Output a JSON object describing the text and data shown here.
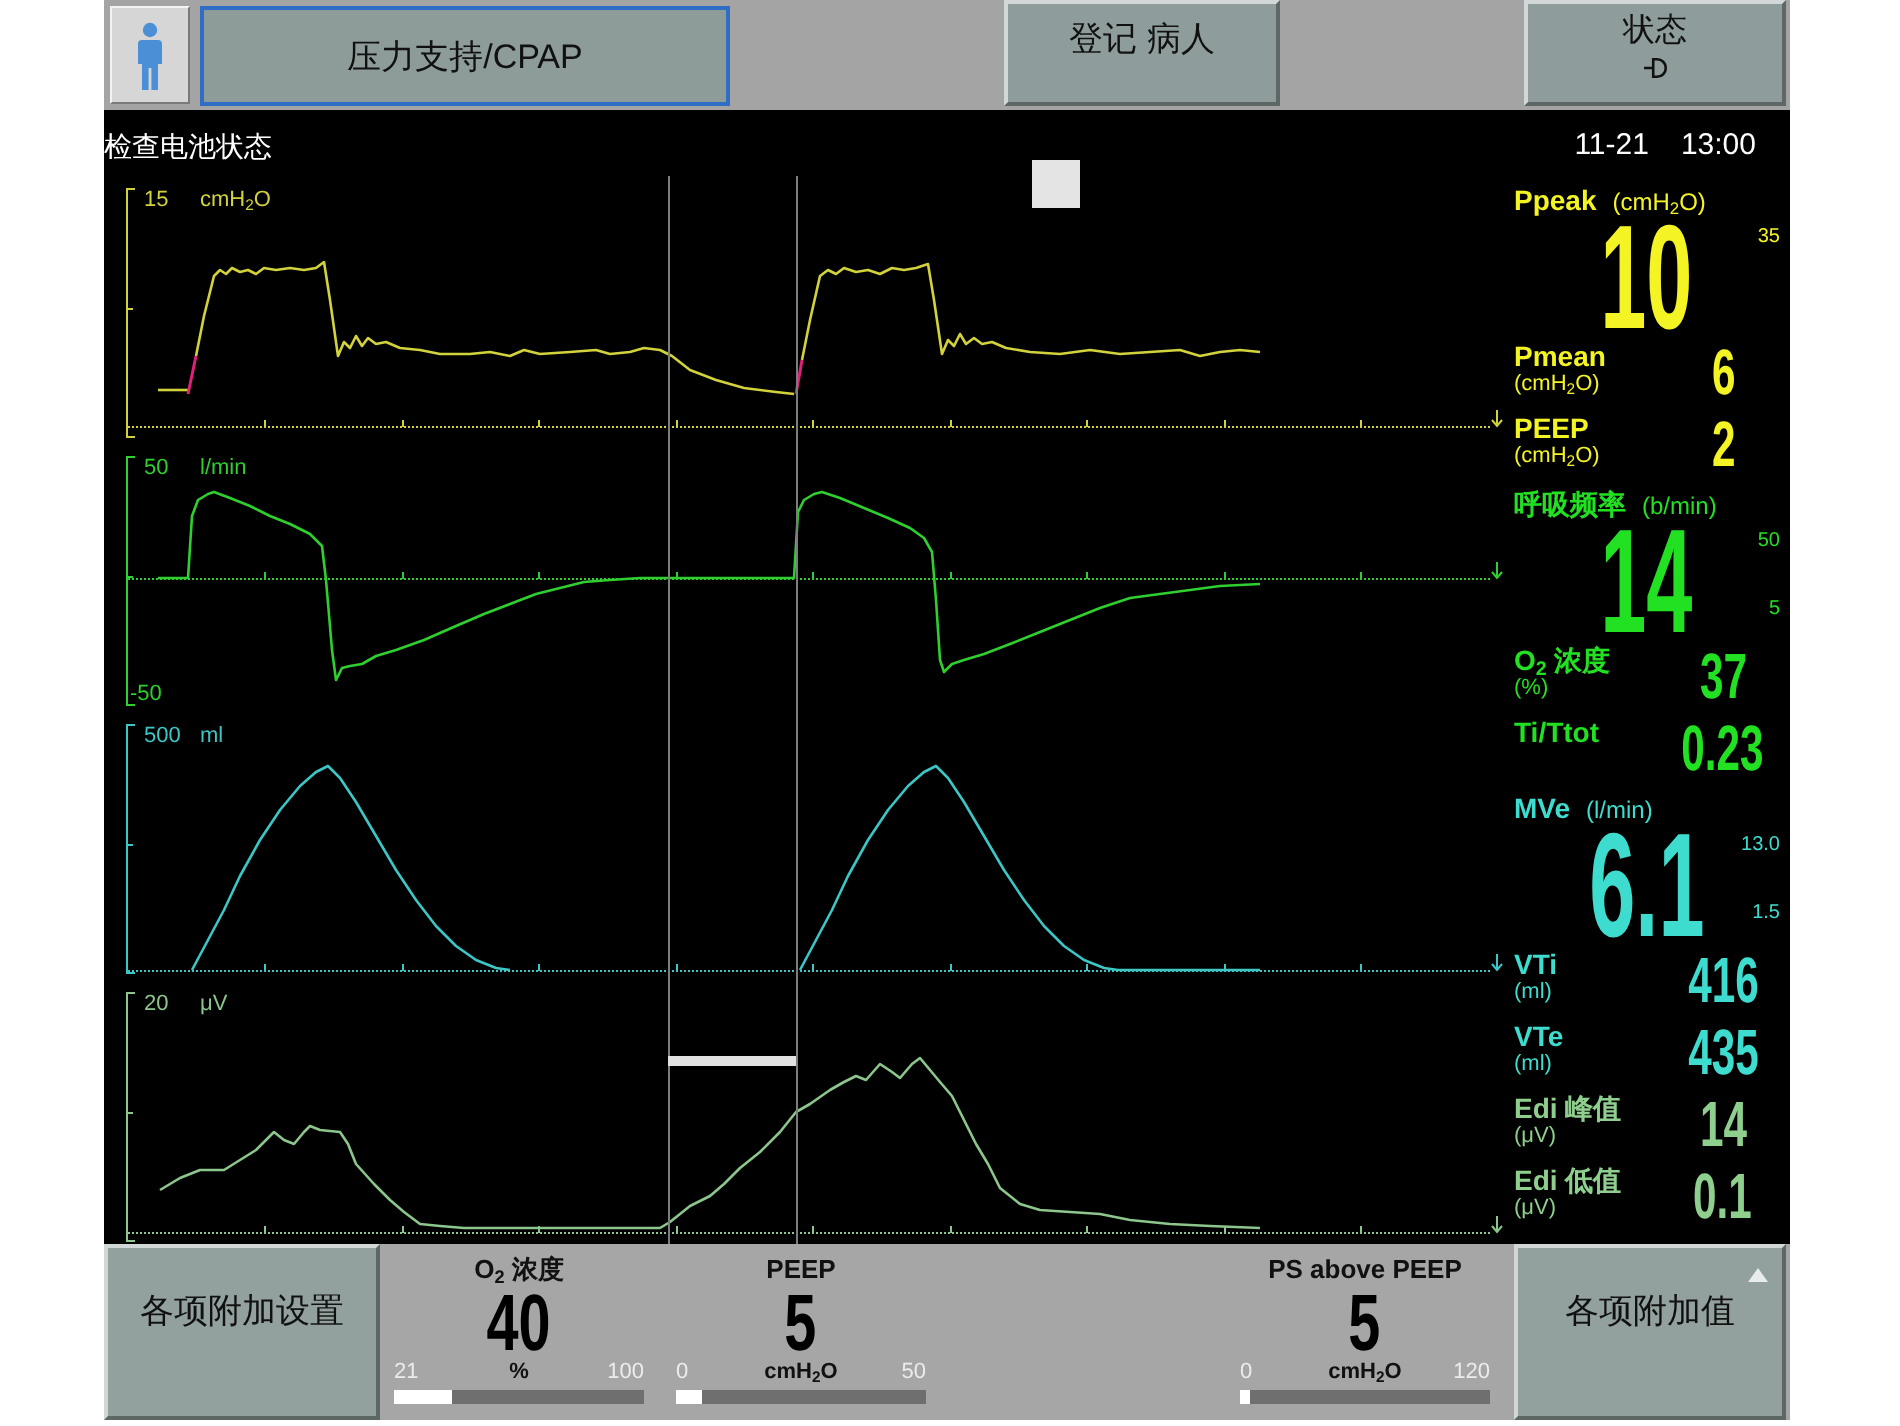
{
  "top_bar": {
    "mode_button": {
      "label": "压力支持/CPAP",
      "selected": true
    },
    "register_button": {
      "label": "登记 病人"
    },
    "status_button": {
      "label": "状态"
    }
  },
  "status_line": {
    "message": "检查电池状态",
    "date": "11-21",
    "time": "13:00"
  },
  "waveforms": [
    {
      "kind": "pressure",
      "color": "#d2d23c",
      "scale_max": "15",
      "unit": "cmH$_{2}$O"
    },
    {
      "kind": "flow",
      "color": "#2fcf2f",
      "scale_max": "50",
      "scale_min": "-50",
      "unit": "l/min"
    },
    {
      "kind": "volume",
      "color": "#3cc6c6",
      "scale_max": "500",
      "unit": "ml"
    },
    {
      "kind": "edi",
      "color": "#8cc68c",
      "scale_max": "20",
      "unit": "μV"
    }
  ],
  "measurements": [
    {
      "kind": "large",
      "label": "Ppeak",
      "unit": "(cmH$_{2}$O)",
      "value": "10",
      "color": "#f4f424",
      "upper_limit": "35"
    },
    {
      "kind": "small",
      "label": "Pmean",
      "unit": "(cmH$_{2}$O)",
      "value": "6",
      "color": "#f4f424"
    },
    {
      "kind": "small",
      "label": "PEEP",
      "unit": "(cmH$_{2}$O)",
      "value": "2",
      "color": "#f4f424"
    },
    {
      "kind": "large",
      "label": "呼吸频率",
      "unit": "(b/min)",
      "value": "14",
      "color": "#22e022",
      "upper_limit": "50",
      "lower_limit": "5"
    },
    {
      "kind": "small",
      "label": "O$_{2}$ 浓度",
      "unit": "(%)",
      "value": "37",
      "color": "#22e022"
    },
    {
      "kind": "small",
      "label": "Ti/Ttot",
      "value": "0.23",
      "color": "#22e022"
    },
    {
      "kind": "large",
      "label": "MVe",
      "unit": "(l/min)",
      "value": "6.1",
      "color": "#3edccf",
      "upper_limit": "13.0",
      "lower_limit": "1.5"
    },
    {
      "kind": "small",
      "label": "VTi",
      "unit": "(ml)",
      "value": "416",
      "color": "#3edccf"
    },
    {
      "kind": "small",
      "label": "VTe",
      "unit": "(ml)",
      "value": "435",
      "color": "#3edccf"
    },
    {
      "kind": "small",
      "label": "Edi 峰值",
      "unit": "(μV)",
      "value": "14",
      "color": "#8ecf8e"
    },
    {
      "kind": "small",
      "label": "Edi 低值",
      "unit": "(μV)",
      "value": "0.1",
      "color": "#8ecf8e"
    }
  ],
  "settings_bar": {
    "left_button": "各项附加设置",
    "settings": [
      {
        "label": "O$_{2}$ 浓度",
        "value": "40",
        "unit": "%",
        "min": "21",
        "max": "100",
        "level": 0.23
      },
      {
        "label": "PEEP",
        "value": "5",
        "unit": "cmH$_{2}$O",
        "min": "0",
        "max": "50",
        "level": 0.1
      },
      {
        "label": "PS above PEEP",
        "value": "5",
        "unit": "cmH$_{2}$O",
        "min": "0",
        "max": "120",
        "level": 0.04
      }
    ],
    "right_button": "各项附加值"
  }
}
